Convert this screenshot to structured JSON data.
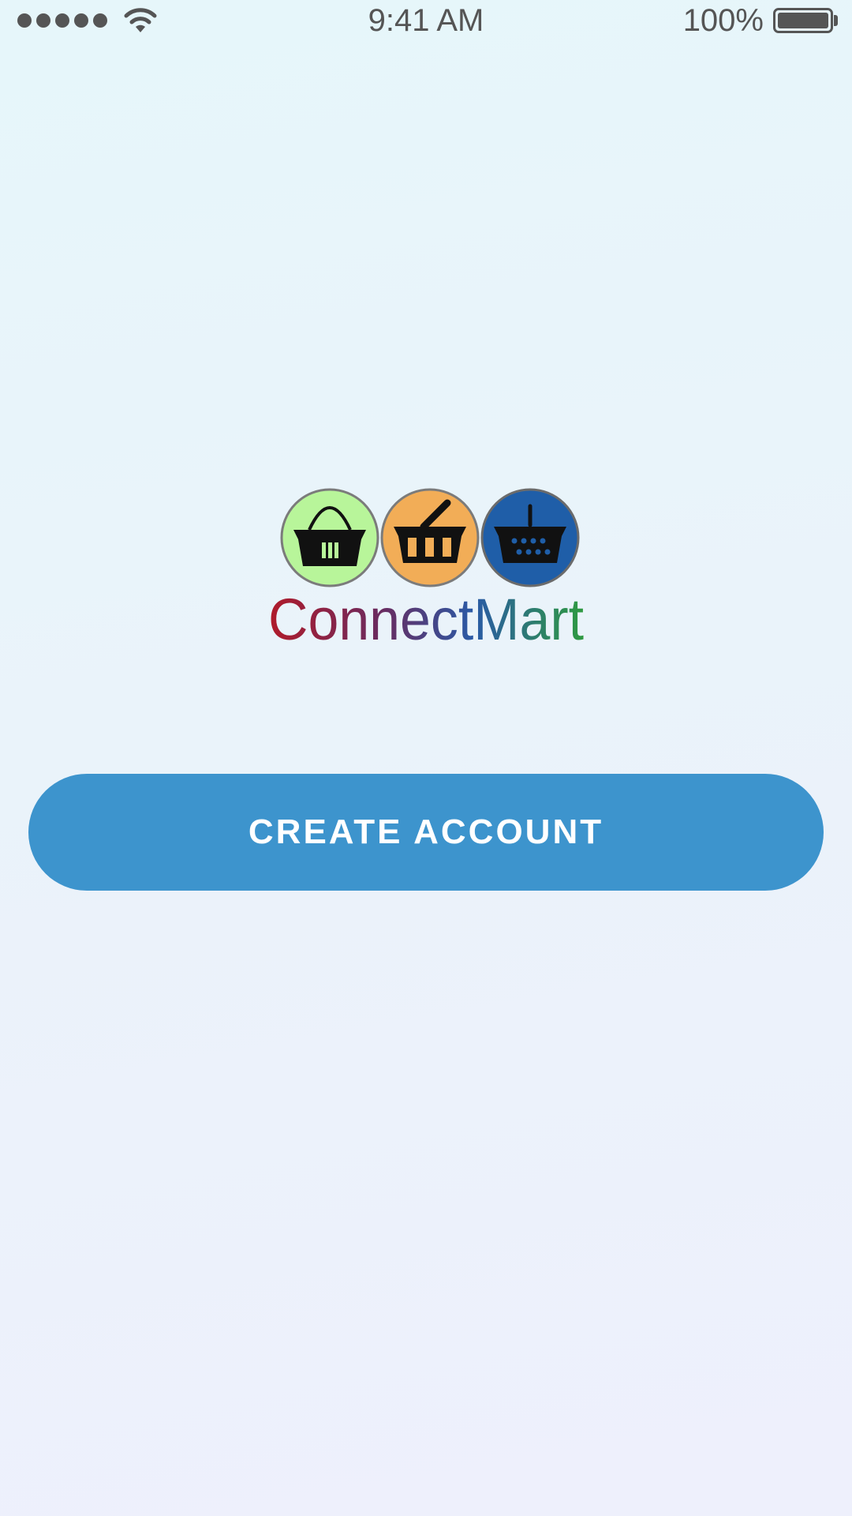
{
  "status_bar": {
    "signal_icon": "signal-dots-icon",
    "wifi_icon": "wifi-icon",
    "time": "9:41 AM",
    "battery_percent": "100%",
    "battery_icon": "battery-icon",
    "battery_level": 1.0
  },
  "logo": {
    "brand_name": "ConnectMart",
    "icons": [
      "basket-icon-green",
      "basket-icon-orange",
      "basket-icon-blue"
    ],
    "colors": {
      "green_circle": "#b8f59a",
      "orange_circle": "#f2ad57",
      "blue_circle": "#1f5ea8"
    }
  },
  "actions": {
    "create_account_label": "CREATE ACCOUNT"
  },
  "theme": {
    "button_color": "#3d94cd",
    "button_text_color": "#ffffff",
    "status_text_color": "#555555"
  }
}
